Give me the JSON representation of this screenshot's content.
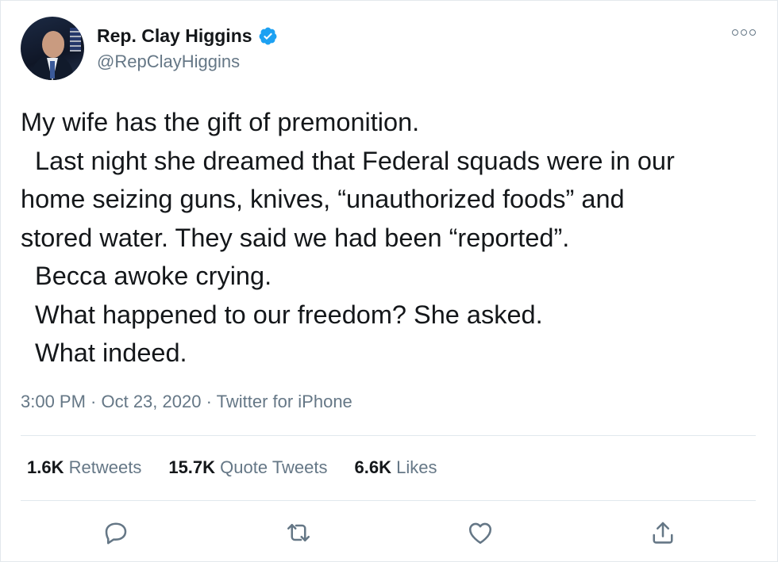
{
  "user": {
    "display_name": "Rep. Clay Higgins",
    "handle": "@RepClayHiggins",
    "verified": true
  },
  "tweet": {
    "lines": [
      "My wife has the gift of premonition.",
      "  Last night she dreamed that Federal squads were in our",
      "home seizing guns, knives, “unauthorized foods” and",
      "stored water. They said we had been “reported”.",
      "  Becca awoke crying.",
      "  What happened to our freedom? She asked.",
      "  What indeed."
    ],
    "meta": "3:00 PM · Oct 23, 2020 · Twitter for iPhone"
  },
  "stats": {
    "retweets_count": "1.6K",
    "retweets_label": "Retweets",
    "quotes_count": "15.7K",
    "quotes_label": "Quote Tweets",
    "likes_count": "6.6K",
    "likes_label": "Likes"
  },
  "colors": {
    "text": "#14171a",
    "secondary": "#657786",
    "verified": "#1da1f2",
    "divider": "#e1e8ed"
  },
  "icons": [
    "verified-icon",
    "more-icon",
    "reply-icon",
    "retweet-icon",
    "like-icon",
    "share-icon"
  ]
}
